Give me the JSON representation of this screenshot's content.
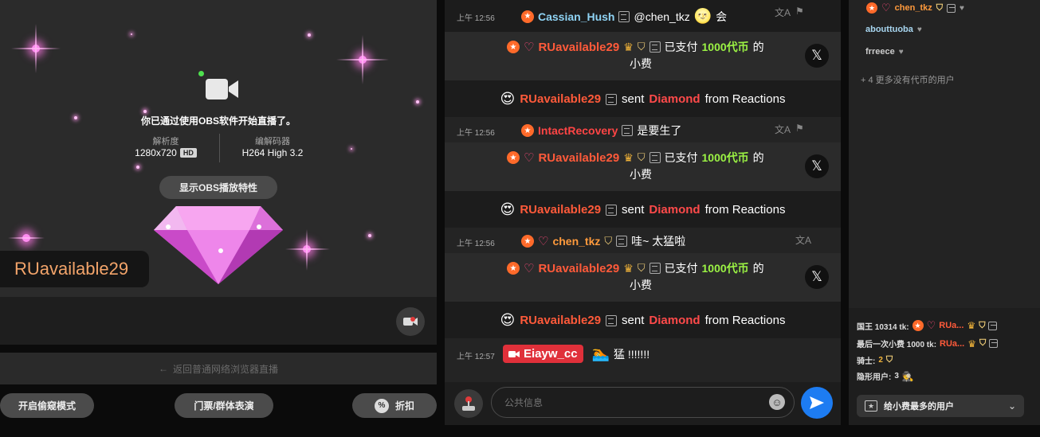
{
  "stream": {
    "obs_title": "你已通过使用OBS软件开始直播了。",
    "resolution_label": "解析度",
    "resolution_value": "1280x720",
    "hd_badge": "HD",
    "encoder_label": "编解码器",
    "encoder_value": "H264 High 3.2",
    "obs_button": "显示OBS播放特性",
    "gift_username": "RUavailable29"
  },
  "controls": {
    "return_text": "返回普通网络浏览器直播",
    "spy_mode": "开启偷窥模式",
    "ticket_show": "门票/群体表演",
    "discount": "折扣",
    "discount_icon": "%"
  },
  "chat": {
    "messages": [
      {
        "time": "上午 12:56",
        "user": "Cassian_Hush",
        "text": "@chen_tkz",
        "emoji": "会"
      },
      {
        "tip_user": "RUavailable29",
        "tip_pre": "已支付",
        "tip_amount": "1000代币",
        "tip_post": "的",
        "tip_line2": "小费"
      },
      {
        "gift_user": "RUavailable29",
        "sent": "sent",
        "gift": "Diamond",
        "from": "from Reactions"
      },
      {
        "time": "上午 12:56",
        "user": "IntactRecovery",
        "text": "是要生了"
      },
      {
        "tip_user": "RUavailable29",
        "tip_pre": "已支付",
        "tip_amount": "1000代币",
        "tip_post": "的",
        "tip_line2": "小费"
      },
      {
        "gift_user": "RUavailable29",
        "sent": "sent",
        "gift": "Diamond",
        "from": "from Reactions"
      },
      {
        "time": "上午 12:56",
        "user": "chen_tkz",
        "text": "哇~ 太猛啦"
      },
      {
        "tip_user": "RUavailable29",
        "tip_pre": "已支付",
        "tip_amount": "1000代币",
        "tip_post": "的",
        "tip_line2": "小费"
      },
      {
        "gift_user": "RUavailable29",
        "sent": "sent",
        "gift": "Diamond",
        "from": "from Reactions"
      },
      {
        "time": "上午 12:57",
        "user": "Eiayw_cc",
        "text": "猛 !!!!!!!"
      }
    ],
    "input_placeholder": "公共信息"
  },
  "users": {
    "list": [
      "chen_tkz",
      "abouttuoba",
      "frreece"
    ],
    "more": "+ 4 更多没有代币的用户",
    "king_label": "国王 10314 tk:",
    "king_user": "RUa...",
    "last_tip_label": "最后一次小费 1000 tk:",
    "last_tip_user": "RUa...",
    "knights_label": "骑士:",
    "knights_count": "2",
    "hidden_label": "隐形用户:",
    "hidden_count": "3",
    "top_tipper_select": "给小费最多的用户"
  },
  "colors": {
    "accent_blue": "#1d7cf2",
    "tip_green": "#9bf244",
    "diamond_red": "#ff4a4a",
    "gift_orange": "#ff5a3a"
  },
  "icons": [
    "video-camera-icon",
    "diamond-icon",
    "x-icon",
    "translate-icon",
    "flag-icon",
    "crown-icon",
    "shield-icon",
    "heart-icon",
    "star-badge-icon",
    "send-icon",
    "emoji-icon",
    "joystick-icon",
    "arrow-left-icon",
    "percent-icon",
    "chevron-down-icon",
    "spy-icon"
  ]
}
